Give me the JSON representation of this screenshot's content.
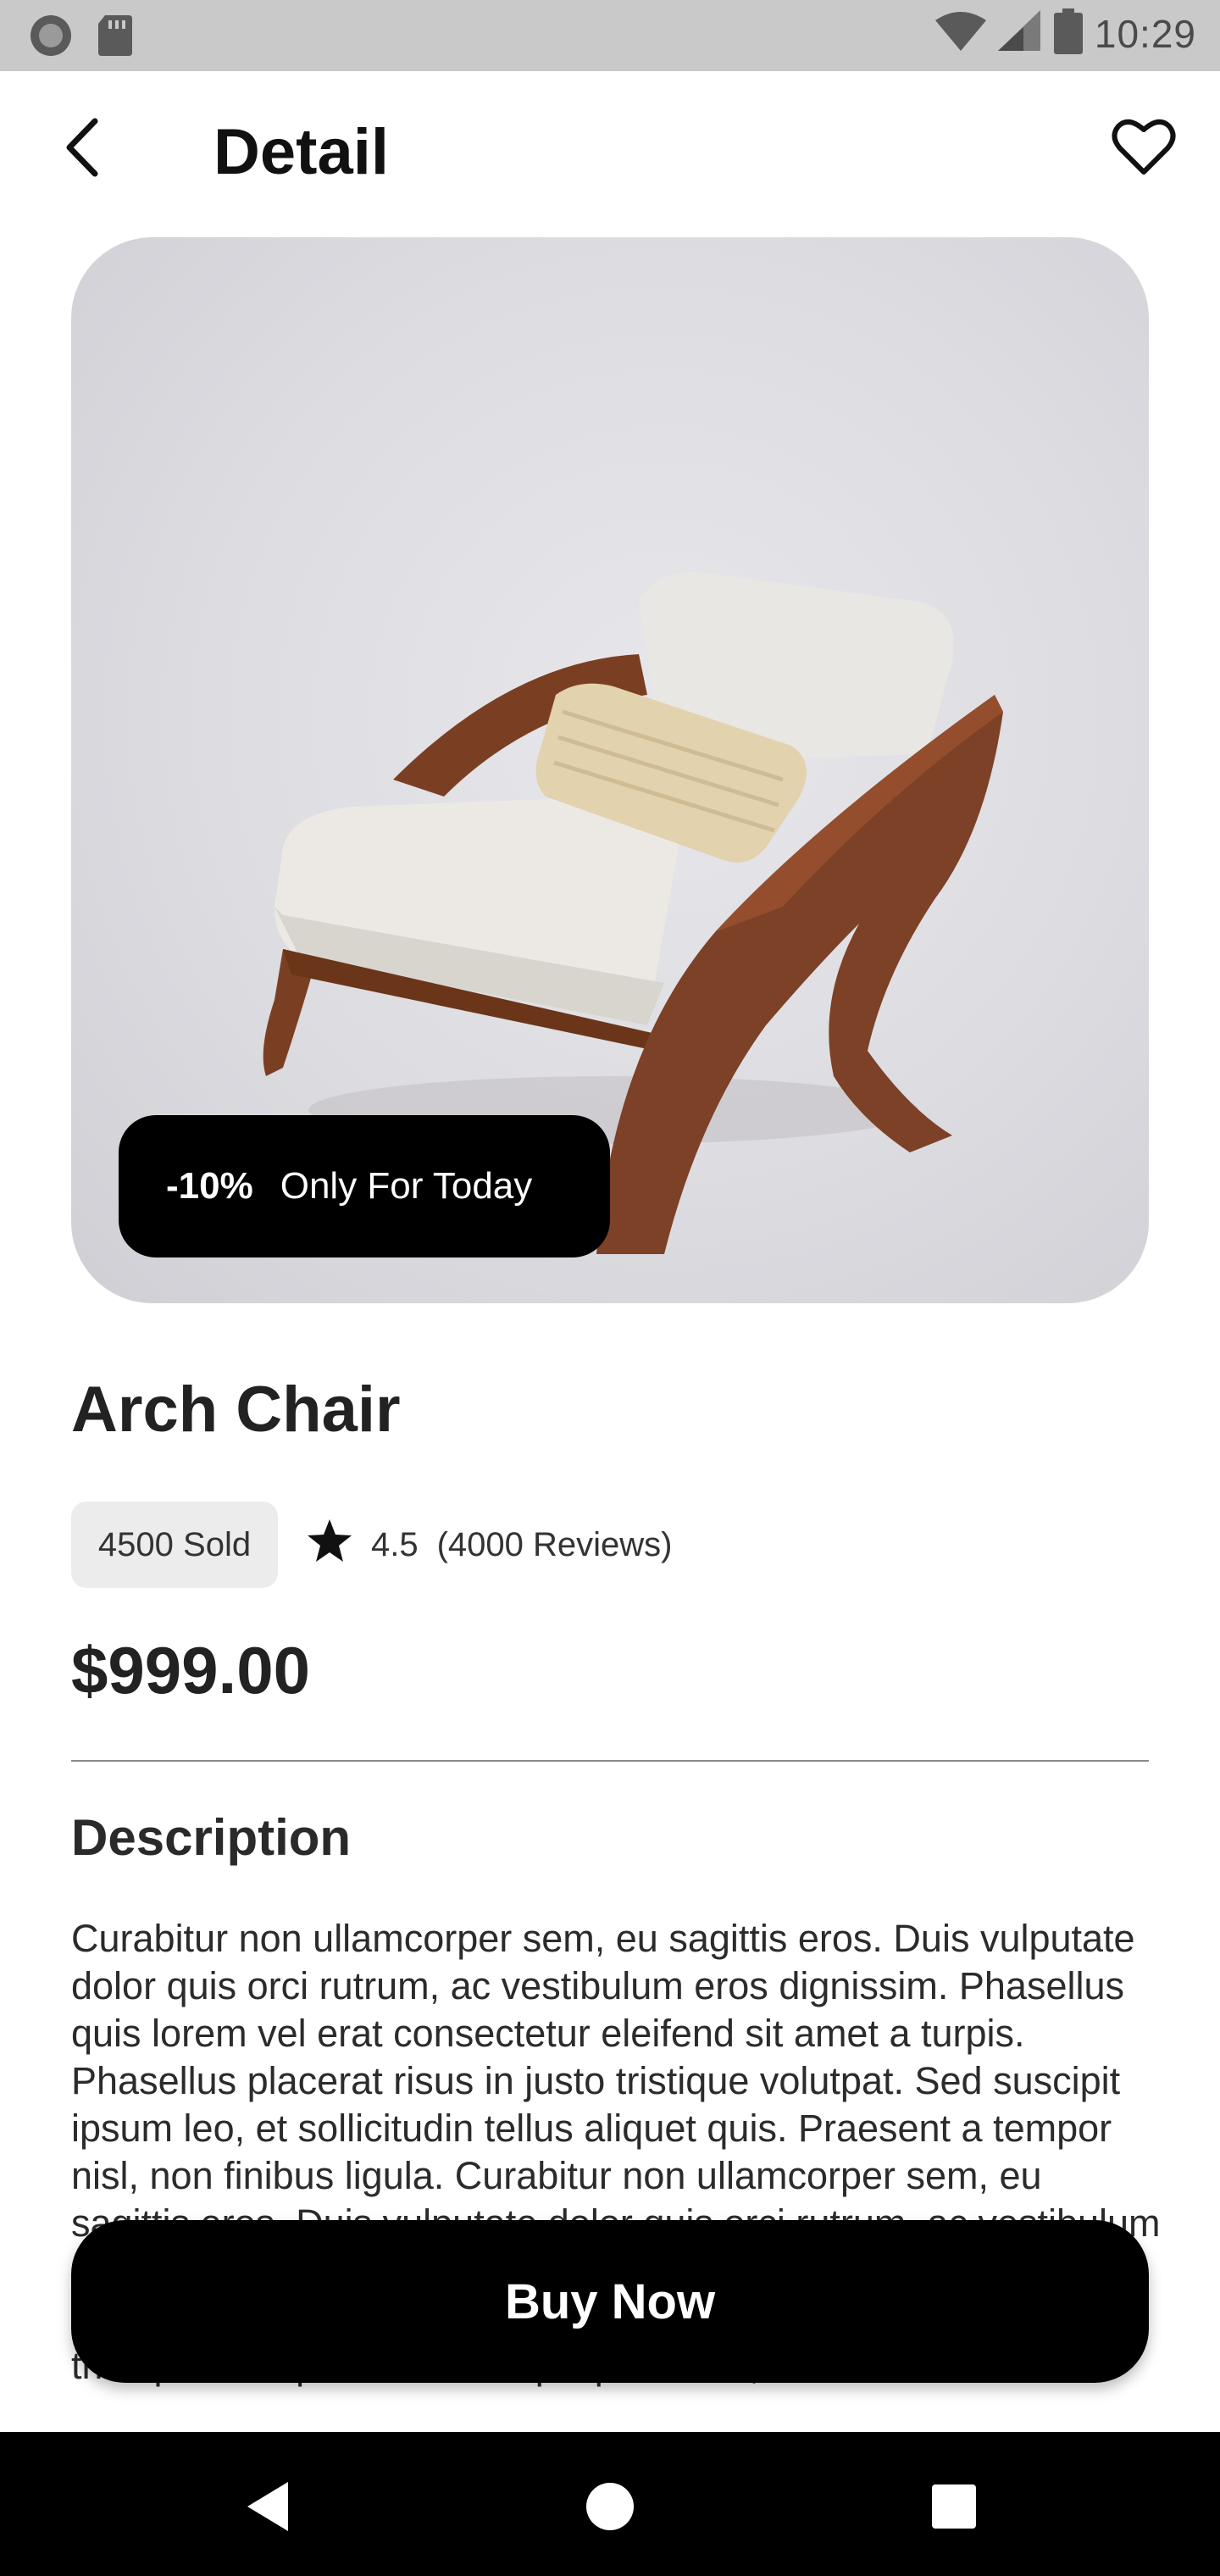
{
  "status_bar": {
    "time": "10:29",
    "icons": [
      "record-icon",
      "sd-card-icon",
      "wifi-icon",
      "signal-icon",
      "battery-icon"
    ]
  },
  "header": {
    "title": "Detail",
    "back_icon": "chevron-left-icon",
    "favorite_icon": "heart-outline-icon"
  },
  "hero": {
    "image": "arch-chair-photo",
    "promo": {
      "percent": "-10%",
      "text": "Only For Today"
    }
  },
  "product": {
    "name": "Arch Chair",
    "sold": "4500 Sold",
    "rating": "4.5",
    "reviews": "(4000 Reviews)",
    "price": "$999.00"
  },
  "description": {
    "title": "Description",
    "body": "Curabitur non ullamcorper sem, eu sagittis eros. Duis vulputate dolor quis orci rutrum, ac vestibulum eros dignissim. Phasellus quis lorem vel erat consectetur eleifend sit amet a turpis. Phasellus placerat risus in justo tristique volutpat. Sed suscipit ipsum leo, et sollicitudin tellus aliquet quis. Praesent a tempor nisl, non finibus ligula. Curabitur non ullamcorper sem, eu sagittis eros. Duis vulputate dolor quis orci rutrum, ac vestibulum eros dignissim. Phasellus quis lorem vel erat consectetur eleifend sit amet a turpis. Phasellus placerat risus in justo tristique volutpat. Sed suscipit ipsum leo, et sollicitudin"
  },
  "actions": {
    "buy_label": "Buy Now"
  },
  "nav": {
    "icons": [
      "nav-back-icon",
      "nav-home-icon",
      "nav-recents-icon"
    ]
  },
  "colors": {
    "primary": "#000000",
    "chip_bg": "#ececec",
    "status_bar": "#c9c9c9"
  }
}
